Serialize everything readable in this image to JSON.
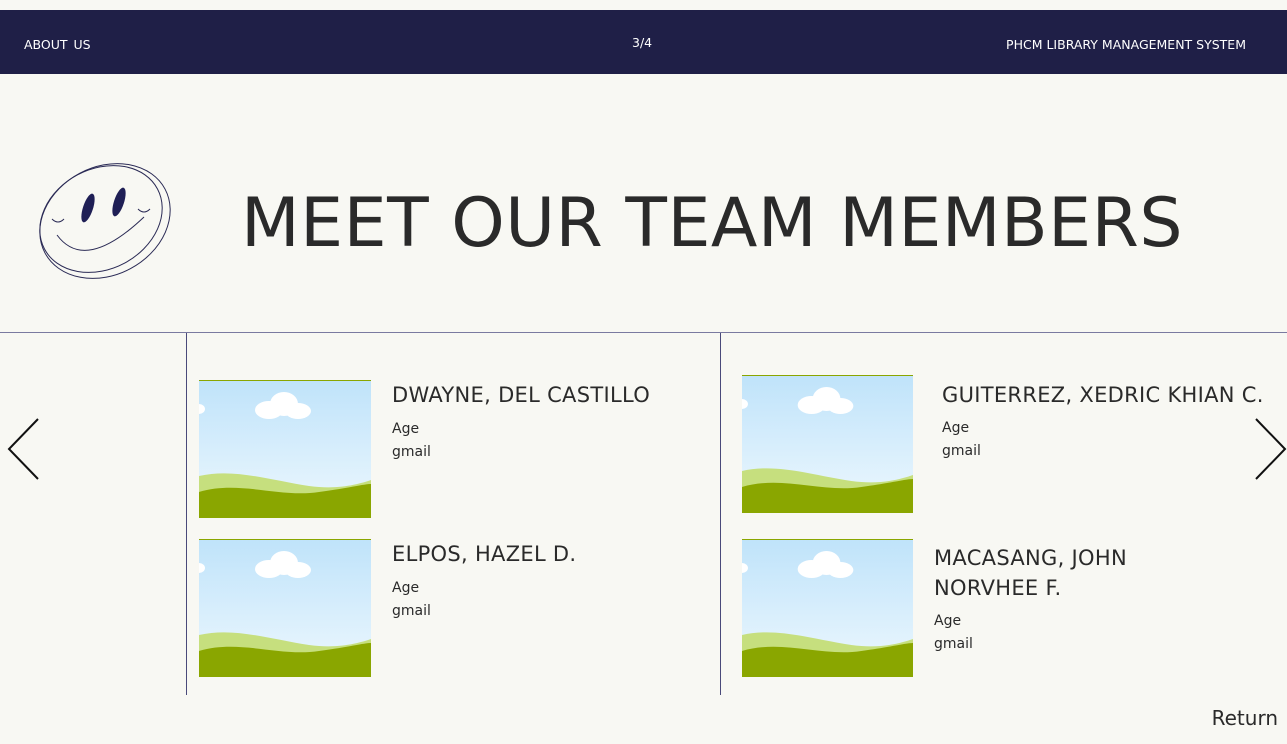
{
  "topbar": {
    "section": "ABOUT  US",
    "page_indicator": "3/4",
    "system_name": "PHCM LIBRARY MANAGEMENT SYSTEM"
  },
  "heading": "MEET OUR TEAM MEMBERS",
  "members": [
    {
      "name": "DWAYNE, DEL CASTILLO",
      "age_label": "Age",
      "email_label": "gmail"
    },
    {
      "name": "ELPOS, HAZEL D.",
      "age_label": "Age",
      "email_label": "gmail"
    },
    {
      "name": "GUITERREZ, XEDRIC KHIAN C.",
      "age_label": "Age",
      "email_label": "gmail"
    },
    {
      "name_line1": "MACASANG, JOHN",
      "name_line2": "NORVHEE F.",
      "age_label": "Age",
      "email_label": "gmail"
    }
  ],
  "nav": {
    "return_label": "Return",
    "prev_icon": "chevron-left-icon",
    "next_icon": "chevron-right-icon"
  },
  "colors": {
    "topbar": "#1f1f47",
    "background": "#f8f8f3",
    "text": "#2a2a2a"
  }
}
